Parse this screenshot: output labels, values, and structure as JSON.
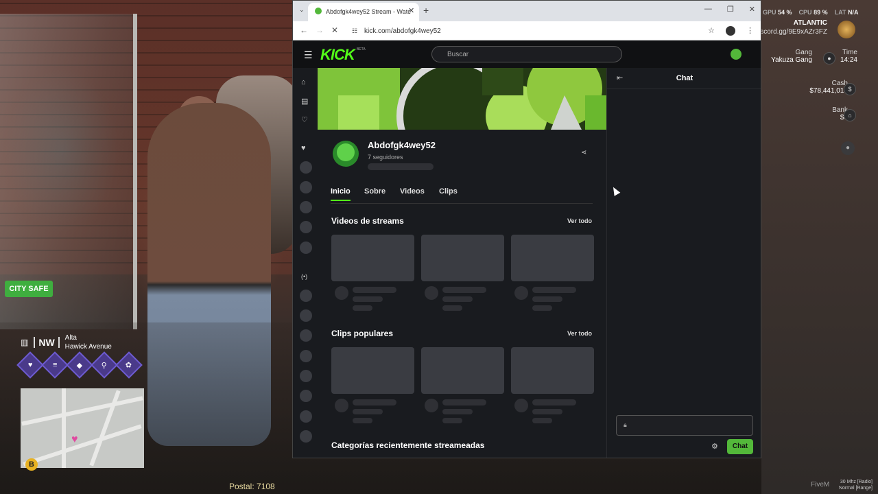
{
  "hud": {
    "gpu_label": "GPU",
    "gpu_value": "54 %",
    "cpu_label": "CPU",
    "cpu_value": "89 %",
    "lat_label": "LAT",
    "lat_value": "N/A",
    "server_name": "ATLANTIC",
    "discord": "scord.gg/9E9xAZr3FZ",
    "gang_label": "Gang",
    "gang_value": "Yakuza Gang",
    "time_label": "Time",
    "time_value": "14:24",
    "cash_label": "Cash",
    "cash_value": "$78,441,014",
    "bank_label": "Bank",
    "bank_value": "$0",
    "zone_badge": "CITY SAFE",
    "compass": "NW",
    "area": "Alta",
    "street": "Hawick Avenue",
    "postal": "Postal: 7108",
    "fivem": "FiveM",
    "radio_line1": "30 Mhz [Radio]",
    "radio_line2": "Normal [Range]"
  },
  "browser": {
    "tab_title": "Abdofgk4wey52 Stream - Watc",
    "url": "kick.com/abdofgk4wey52",
    "minimize": "—",
    "maximize": "❐",
    "close": "✕"
  },
  "kick": {
    "logo": "KICK",
    "beta": "BETA",
    "search_placeholder": "Buscar",
    "channel_name": "Abdofgk4wey52",
    "followers": "7 seguidores",
    "tabs": [
      "Inicio",
      "Sobre",
      "Videos",
      "Clips"
    ],
    "section_videos": "Videos de streams",
    "section_clips": "Clips populares",
    "section_categories": "Categorías recientemente streameadas",
    "see_all": "Ver todo",
    "chat_title": "Chat",
    "chat_button": "Chat"
  }
}
